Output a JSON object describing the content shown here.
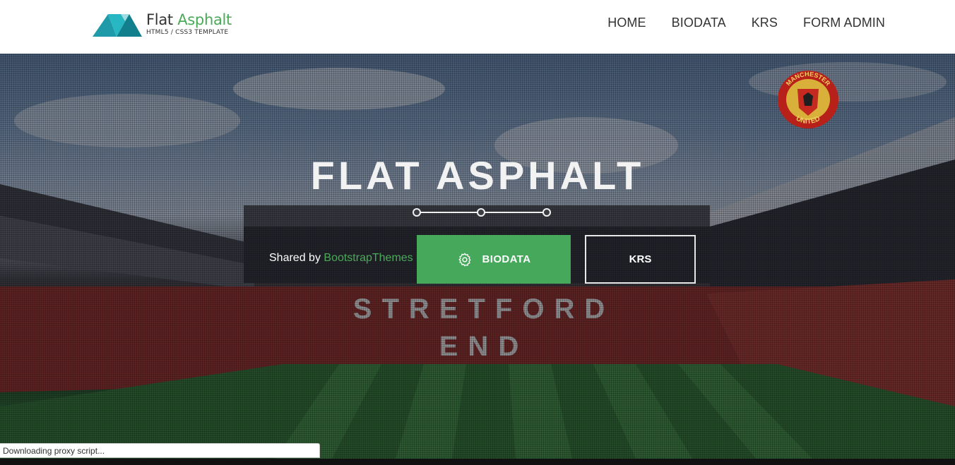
{
  "brand": {
    "title_main": "Flat ",
    "title_accent": "Asphalt",
    "subtitle": "HTML5 / CSS3 TEMPLATE"
  },
  "nav": {
    "items": [
      "HOME",
      "BIODATA",
      "KRS",
      "FORM ADMIN"
    ]
  },
  "hero": {
    "title": "FLAT ASPHALT",
    "shared_prefix": "Shared by ",
    "shared_link": "BootstrapThemes",
    "primary_button": "BIODATA",
    "secondary_button": "KRS",
    "stand_lettering": "STRETFORD END"
  },
  "crest": {
    "top_text": "MANCHESTER",
    "bottom_text": "UNITED"
  },
  "status_bar": {
    "text": "Downloading proxy script..."
  },
  "colors": {
    "accent": "#4aaa58",
    "button_green": "#45a85a",
    "logo_teal": "#1fa6b0"
  },
  "icons": {
    "primary_button_icon": "gear-icon"
  }
}
